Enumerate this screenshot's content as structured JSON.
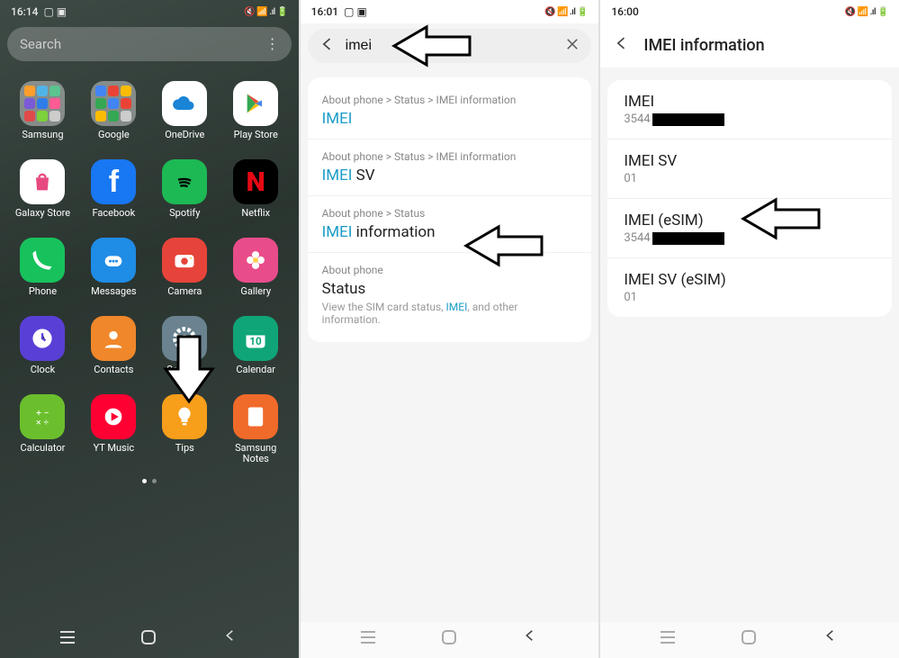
{
  "phone1": {
    "time": "16:14",
    "status_icons": "⬚☰",
    "right_icons": "📶📶🔋",
    "search_placeholder": "Search",
    "apps": [
      {
        "label": "Samsung",
        "type": "folder",
        "colors": [
          "#ff9e2c",
          "#51b4e6",
          "#5bc48f",
          "#7a5ad6",
          "#2e7de9",
          "#ff5b95",
          "#e04a4a",
          "#7cd23a",
          "#ccc"
        ]
      },
      {
        "label": "Google",
        "type": "folder",
        "colors": [
          "#4285f4",
          "#ea4335",
          "#fbbc05",
          "#34a853",
          "#4285f4",
          "#ea4335",
          "#fbbc05",
          "#34a853",
          "#ccc"
        ]
      },
      {
        "label": "OneDrive",
        "bg": "#ffffff",
        "glyph": "cloud",
        "fg": "#1a84d6"
      },
      {
        "label": "Play Store",
        "bg": "#ffffff",
        "glyph": "play",
        "fg": "#01875f"
      },
      {
        "label": "Galaxy Store",
        "bg": "#ffffff",
        "glyph": "bag",
        "fg": "#e64980"
      },
      {
        "label": "Facebook",
        "bg": "#1877f2",
        "glyph": "f",
        "fg": "#fff"
      },
      {
        "label": "Spotify",
        "bg": "#1db954",
        "glyph": "spotify",
        "fg": "#000"
      },
      {
        "label": "Netflix",
        "bg": "#000000",
        "glyph": "N",
        "fg": "#e50914"
      },
      {
        "label": "Phone",
        "bg": "#17c25c",
        "glyph": "phone",
        "fg": "#fff"
      },
      {
        "label": "Messages",
        "bg": "#1f8ce6",
        "glyph": "msg",
        "fg": "#fff"
      },
      {
        "label": "Camera",
        "bg": "#e6443a",
        "glyph": "cam",
        "fg": "#fff"
      },
      {
        "label": "Gallery",
        "bg": "#e84d8a",
        "glyph": "flower",
        "fg": "#fff"
      },
      {
        "label": "Clock",
        "bg": "#5a3fd6",
        "glyph": "clock",
        "fg": "#fff"
      },
      {
        "label": "Contacts",
        "bg": "#f0872a",
        "glyph": "person",
        "fg": "#fff"
      },
      {
        "label": "Settings",
        "bg": "#6b8390",
        "glyph": "gear",
        "fg": "#fff"
      },
      {
        "label": "Calendar",
        "bg": "#0fa578",
        "glyph": "cal",
        "fg": "#fff",
        "text": "10"
      },
      {
        "label": "Calculator",
        "bg": "#6bbf2d",
        "glyph": "calc",
        "fg": "#fff"
      },
      {
        "label": "YT Music",
        "bg": "#ff0033",
        "glyph": "ytplay",
        "fg": "#fff"
      },
      {
        "label": "Tips",
        "bg": "#f79e1b",
        "glyph": "bulb",
        "fg": "#fff"
      },
      {
        "label": "Samsung Notes",
        "bg": "#f06a2a",
        "glyph": "note",
        "fg": "#fff"
      }
    ]
  },
  "phone2": {
    "time": "16:01",
    "search_value": "imei",
    "results": [
      {
        "crumb": "About phone > Status > IMEI information",
        "title_hl": "IMEI",
        "title_rest": ""
      },
      {
        "crumb": "About phone > Status > IMEI information",
        "title_hl": "IMEI",
        "title_rest": " SV"
      },
      {
        "crumb": "About phone > Status",
        "title_hl": "IMEI",
        "title_rest": " information"
      },
      {
        "crumb": "About phone",
        "title_black": "Status",
        "sub_pre": "View the SIM card status, ",
        "sub_hl": "IMEI",
        "sub_post": ", and other information."
      }
    ]
  },
  "phone3": {
    "time": "16:00",
    "title": "IMEI information",
    "items": [
      {
        "label": "IMEI",
        "prefix": "3544",
        "redacted": true
      },
      {
        "label": "IMEI SV",
        "value": "01"
      },
      {
        "label": "IMEI (eSIM)",
        "prefix": "3544",
        "redacted": true
      },
      {
        "label": "IMEI SV (eSIM)",
        "value": "01"
      }
    ]
  }
}
